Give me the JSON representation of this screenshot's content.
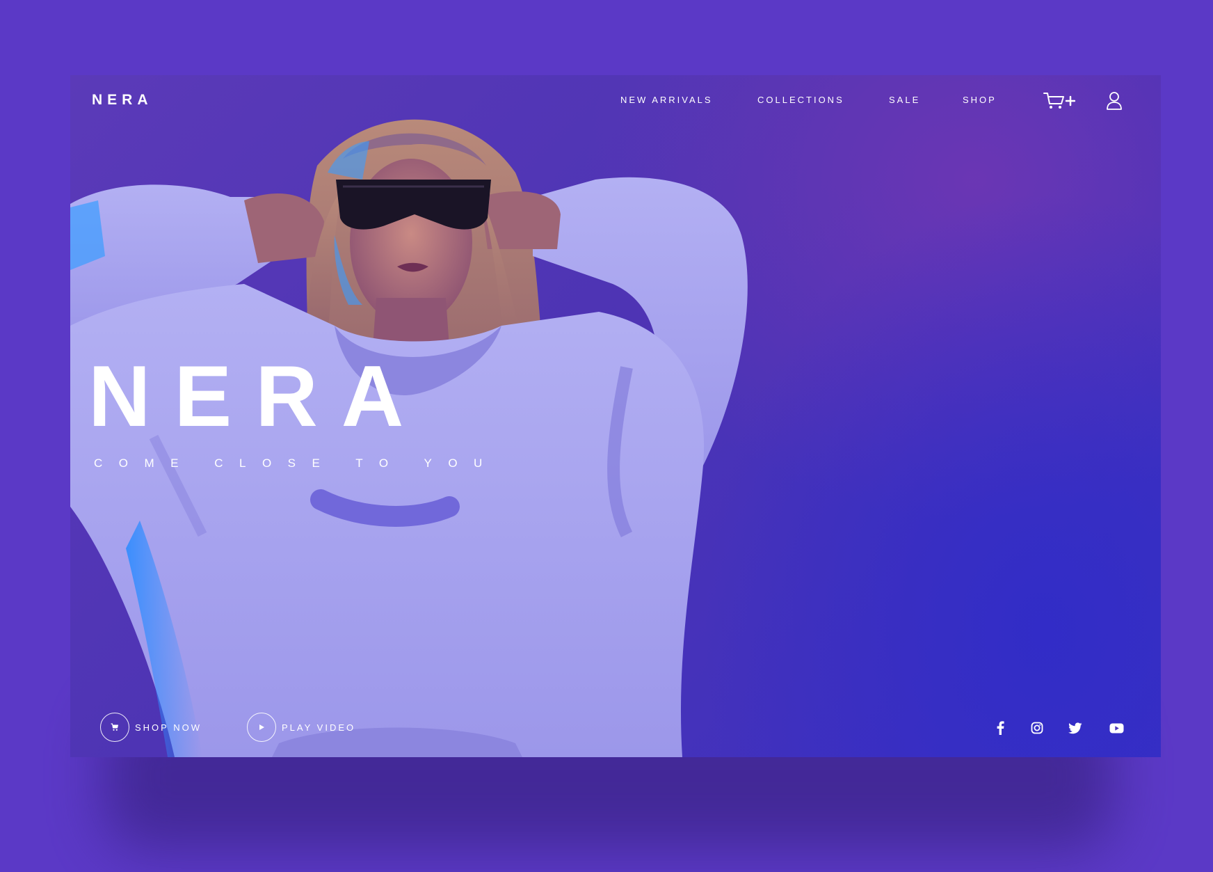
{
  "brand": {
    "logo": "NERA"
  },
  "nav": {
    "items": [
      {
        "label": "NEW ARRIVALS"
      },
      {
        "label": "COLLECTIONS"
      },
      {
        "label": "SALE"
      },
      {
        "label": "SHOP"
      }
    ],
    "icons": [
      "cart-plus-icon",
      "user-icon"
    ]
  },
  "hero": {
    "title": "NERA",
    "subtitle": "COME CLOSE TO YOU"
  },
  "actions": {
    "shop_now": "SHOP NOW",
    "play_video": "PLAY VIDEO"
  },
  "social": [
    "facebook-icon",
    "instagram-icon",
    "twitter-icon",
    "youtube-icon"
  ],
  "colors": {
    "page_background": "#5b39c6",
    "hero_background": "#4d34b4",
    "hoodie": "#a9a4ee",
    "text": "#ffffff"
  }
}
